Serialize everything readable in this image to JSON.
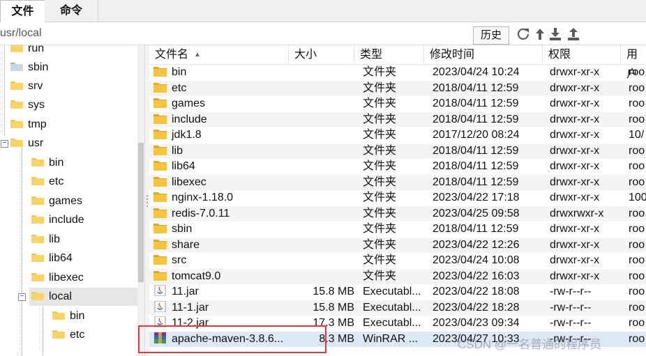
{
  "tabs": [
    "文件",
    "命令"
  ],
  "path": {
    "value": "usr/local"
  },
  "toolbar": {
    "history_label": "历史",
    "icons": [
      "refresh-icon",
      "up-icon",
      "download-icon",
      "upload-icon"
    ]
  },
  "tree": {
    "items": [
      {
        "label": "run",
        "level": 1
      },
      {
        "label": "sbin",
        "level": 1
      },
      {
        "label": "srv",
        "level": 1
      },
      {
        "label": "sys",
        "level": 1
      },
      {
        "label": "tmp",
        "level": 1
      },
      {
        "label": "usr",
        "level": 1,
        "expanded": true
      },
      {
        "label": "bin",
        "level": 2
      },
      {
        "label": "etc",
        "level": 2
      },
      {
        "label": "games",
        "level": 2
      },
      {
        "label": "include",
        "level": 2
      },
      {
        "label": "lib",
        "level": 2
      },
      {
        "label": "lib64",
        "level": 2
      },
      {
        "label": "libexec",
        "level": 2
      },
      {
        "label": "local",
        "level": 2,
        "expanded": true,
        "selected": true
      },
      {
        "label": "bin",
        "level": 3
      },
      {
        "label": "etc",
        "level": 3
      }
    ]
  },
  "columns": [
    "文件名",
    "大小",
    "类型",
    "修改时间",
    "权限",
    "用户"
  ],
  "files": [
    {
      "name": "bin",
      "size": "",
      "type": "文件夹",
      "modified": "2023/04/24 10:24",
      "perm": "drwxr-xr-x",
      "user": "roo",
      "icon": "folder-icon"
    },
    {
      "name": "etc",
      "size": "",
      "type": "文件夹",
      "modified": "2018/04/11 12:59",
      "perm": "drwxr-xr-x",
      "user": "roo",
      "icon": "folder-icon"
    },
    {
      "name": "games",
      "size": "",
      "type": "文件夹",
      "modified": "2018/04/11 12:59",
      "perm": "drwxr-xr-x",
      "user": "roo",
      "icon": "folder-icon"
    },
    {
      "name": "include",
      "size": "",
      "type": "文件夹",
      "modified": "2018/04/11 12:59",
      "perm": "drwxr-xr-x",
      "user": "roo",
      "icon": "folder-icon"
    },
    {
      "name": "jdk1.8",
      "size": "",
      "type": "文件夹",
      "modified": "2017/12/20 08:24",
      "perm": "drwxr-xr-x",
      "user": "10/",
      "icon": "folder-icon"
    },
    {
      "name": "lib",
      "size": "",
      "type": "文件夹",
      "modified": "2018/04/11 12:59",
      "perm": "drwxr-xr-x",
      "user": "roo",
      "icon": "folder-icon"
    },
    {
      "name": "lib64",
      "size": "",
      "type": "文件夹",
      "modified": "2018/04/11 12:59",
      "perm": "drwxr-xr-x",
      "user": "roo",
      "icon": "folder-icon"
    },
    {
      "name": "libexec",
      "size": "",
      "type": "文件夹",
      "modified": "2018/04/11 12:59",
      "perm": "drwxr-xr-x",
      "user": "roo",
      "icon": "folder-icon"
    },
    {
      "name": "nginx-1.18.0",
      "size": "",
      "type": "文件夹",
      "modified": "2023/04/22 17:18",
      "perm": "drwxr-xr-x",
      "user": "100",
      "icon": "folder-icon"
    },
    {
      "name": "redis-7.0.11",
      "size": "",
      "type": "文件夹",
      "modified": "2023/04/25 09:58",
      "perm": "drwxrwxr-x",
      "user": "roo",
      "icon": "folder-icon"
    },
    {
      "name": "sbin",
      "size": "",
      "type": "文件夹",
      "modified": "2018/04/11 12:59",
      "perm": "drwxr-xr-x",
      "user": "roo",
      "icon": "folder-icon"
    },
    {
      "name": "share",
      "size": "",
      "type": "文件夹",
      "modified": "2023/04/22 12:26",
      "perm": "drwxr-xr-x",
      "user": "roo",
      "icon": "folder-icon"
    },
    {
      "name": "src",
      "size": "",
      "type": "文件夹",
      "modified": "2023/04/24 10:08",
      "perm": "drwxr-xr-x",
      "user": "roo",
      "icon": "folder-icon"
    },
    {
      "name": "tomcat9.0",
      "size": "",
      "type": "文件夹",
      "modified": "2023/04/22 16:03",
      "perm": "drwxr-xr-x",
      "user": "roo",
      "icon": "folder-icon"
    },
    {
      "name": "11.jar",
      "size": "15.8 MB",
      "type": "Executabl...",
      "modified": "2023/04/22 18:08",
      "perm": "-rw-r--r--",
      "user": "roo",
      "icon": "java-icon"
    },
    {
      "name": "11-1.jar",
      "size": "15.8 MB",
      "type": "Executabl...",
      "modified": "2023/04/22 18:28",
      "perm": "-rw-r--r--",
      "user": "roo",
      "icon": "java-icon"
    },
    {
      "name": "11-2.jar",
      "size": "17.3 MB",
      "type": "Executabl...",
      "modified": "2023/04/23 09:34",
      "perm": "-rw-r--r--",
      "user": "roo",
      "icon": "java-icon"
    },
    {
      "name": "apache-maven-3.8.6...",
      "size": "8.3 MB",
      "type": "WinRAR ...",
      "modified": "2023/04/27 10:33",
      "perm": "-rw-r--r--",
      "user": "roo",
      "icon": "winrar-icon",
      "selected": true
    }
  ],
  "watermark": "CSDN @一名普通的程序员",
  "colors": {
    "folder": "#f5c542",
    "folder_dark": "#e0a82a",
    "highlight_box": "#e23a3a",
    "selection": "#dde8f6"
  }
}
